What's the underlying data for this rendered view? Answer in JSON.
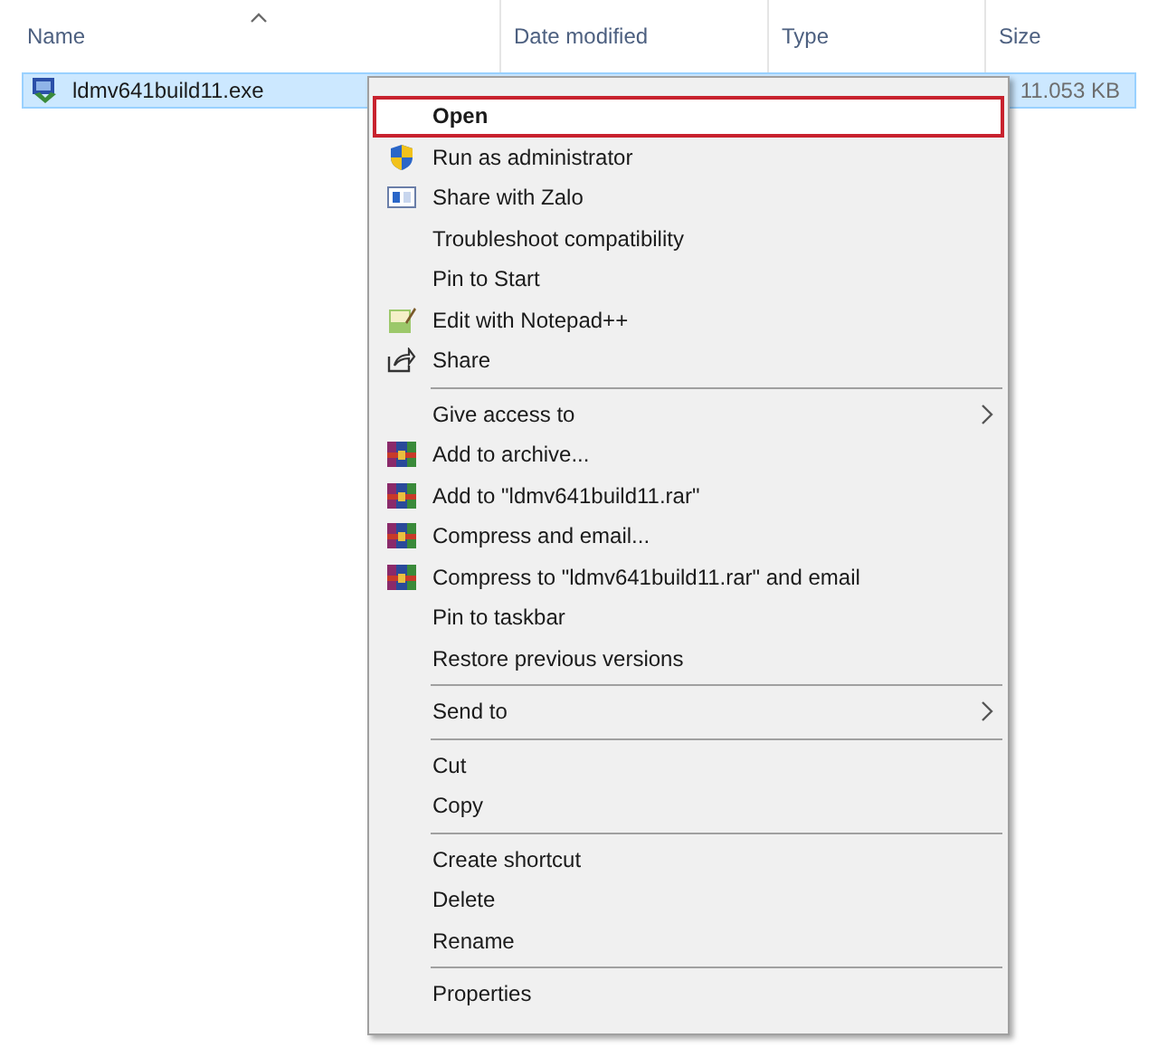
{
  "columns": [
    {
      "label": "Name",
      "sorted": true
    },
    {
      "label": "Date modified",
      "sorted": false
    },
    {
      "label": "Type",
      "sorted": false
    },
    {
      "label": "Size",
      "sorted": false
    }
  ],
  "file": {
    "name": "ldmv641build11.exe",
    "size": "11.053 KB",
    "selected": true
  },
  "menu": {
    "groups": [
      [
        {
          "label": "Open",
          "kind": "plain",
          "selected": true,
          "submenu": false
        },
        {
          "label": "Run as administrator",
          "kind": "shield",
          "selected": false,
          "submenu": false
        },
        {
          "label": "Share with Zalo",
          "kind": "zalo",
          "selected": false,
          "submenu": false
        },
        {
          "label": "Troubleshoot compatibility",
          "kind": "plain",
          "selected": false,
          "submenu": false
        },
        {
          "label": "Pin to Start",
          "kind": "plain",
          "selected": false,
          "submenu": false
        },
        {
          "label": "Edit with Notepad++",
          "kind": "notepad",
          "selected": false,
          "submenu": false
        },
        {
          "label": "Share",
          "kind": "share",
          "selected": false,
          "submenu": false
        }
      ],
      [
        {
          "label": "Give access to",
          "kind": "plain",
          "selected": false,
          "submenu": true
        },
        {
          "label": "Add to archive...",
          "kind": "archive",
          "selected": false,
          "submenu": false
        },
        {
          "label": "Add to \"ldmv641build11.rar\"",
          "kind": "archive",
          "selected": false,
          "submenu": false
        },
        {
          "label": "Compress and email...",
          "kind": "archive",
          "selected": false,
          "submenu": false
        },
        {
          "label": "Compress to \"ldmv641build11.rar\" and email",
          "kind": "archive",
          "selected": false,
          "submenu": false
        },
        {
          "label": "Pin to taskbar",
          "kind": "plain",
          "selected": false,
          "submenu": false
        },
        {
          "label": "Restore previous versions",
          "kind": "plain",
          "selected": false,
          "submenu": false
        }
      ],
      [
        {
          "label": "Send to",
          "kind": "plain",
          "selected": false,
          "submenu": true
        }
      ],
      [
        {
          "label": "Cut",
          "kind": "plain",
          "selected": false,
          "submenu": false
        },
        {
          "label": "Copy",
          "kind": "plain",
          "selected": false,
          "submenu": false
        }
      ],
      [
        {
          "label": "Create shortcut",
          "kind": "plain",
          "selected": false,
          "submenu": false
        },
        {
          "label": "Delete",
          "kind": "plain",
          "selected": false,
          "submenu": false
        },
        {
          "label": "Rename",
          "kind": "plain",
          "selected": false,
          "submenu": false
        }
      ],
      [
        {
          "label": "Properties",
          "kind": "plain",
          "selected": false,
          "submenu": false
        }
      ]
    ]
  }
}
